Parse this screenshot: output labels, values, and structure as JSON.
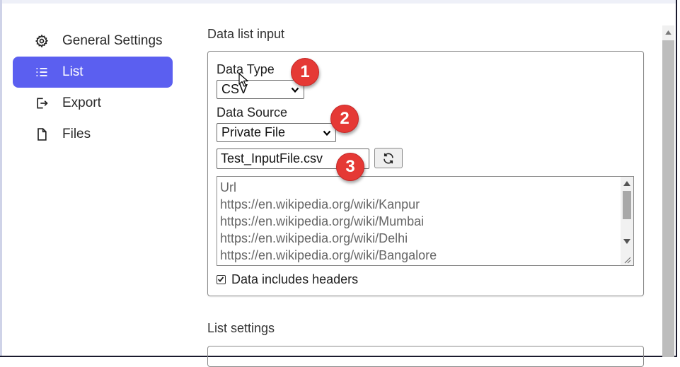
{
  "sidebar": {
    "items": [
      {
        "label": "General Settings",
        "icon": "gear-icon",
        "active": false
      },
      {
        "label": "List",
        "icon": "list-icon",
        "active": true
      },
      {
        "label": "Export",
        "icon": "export-icon",
        "active": false
      },
      {
        "label": "Files",
        "icon": "file-icon",
        "active": false
      }
    ]
  },
  "data_list_input": {
    "title": "Data list input",
    "data_type_label": "Data Type",
    "data_type_value": "CSV",
    "data_source_label": "Data Source",
    "data_source_value": "Private File",
    "file_name": "Test_InputFile.csv",
    "textarea_lines": [
      "Url",
      "https://en.wikipedia.org/wiki/Kanpur",
      "https://en.wikipedia.org/wiki/Mumbai",
      "https://en.wikipedia.org/wiki/Delhi",
      "https://en.wikipedia.org/wiki/Bangalore"
    ],
    "headers_checkbox_label": "Data includes headers",
    "headers_checked": true
  },
  "list_settings": {
    "title": "List settings"
  },
  "callouts": [
    "1",
    "2",
    "3"
  ],
  "colors": {
    "accent": "#5b5ff0",
    "badge": "#e53935"
  }
}
